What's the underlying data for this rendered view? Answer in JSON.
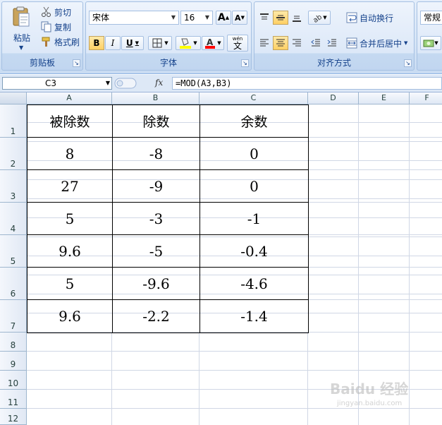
{
  "ribbon": {
    "clipboard": {
      "label": "剪贴板",
      "paste": "粘贴",
      "cut": "剪切",
      "copy": "复制",
      "format_painter": "格式刷"
    },
    "font": {
      "label": "字体",
      "font_name": "宋体",
      "font_size": "16",
      "bold": "B",
      "italic": "I",
      "underline": "U",
      "grow": "A",
      "shrink": "A",
      "phonetic": "wén"
    },
    "alignment": {
      "label": "对齐方式",
      "wrap_text": "自动换行",
      "merge_center": "合并后居中"
    },
    "number": {
      "format": "常规"
    }
  },
  "formula_bar": {
    "cell_ref": "C3",
    "fx": "fx",
    "formula": "=MOD(A3,B3)"
  },
  "columns": [
    "A",
    "B",
    "C",
    "D",
    "E",
    "F"
  ],
  "rows": [
    "1",
    "2",
    "3",
    "4",
    "5",
    "6",
    "7",
    "8",
    "9",
    "10",
    "11",
    "12"
  ],
  "table": {
    "headers": [
      "被除数",
      "除数",
      "余数"
    ],
    "rows": [
      [
        "8",
        "-8",
        "0"
      ],
      [
        "27",
        "-9",
        "0"
      ],
      [
        "5",
        "-3",
        "-1"
      ],
      [
        "9.6",
        "-5",
        "-0.4"
      ],
      [
        "5",
        "-9.6",
        "-4.6"
      ],
      [
        "9.6",
        "-2.2",
        "-1.4"
      ]
    ]
  },
  "watermark": {
    "text": "Baidu 经验",
    "sub": "jingyan.baidu.com"
  },
  "colors": {
    "ribbon": "#dce8f8",
    "grid_line": "#d0d7e5",
    "header_text": "#15428b"
  }
}
